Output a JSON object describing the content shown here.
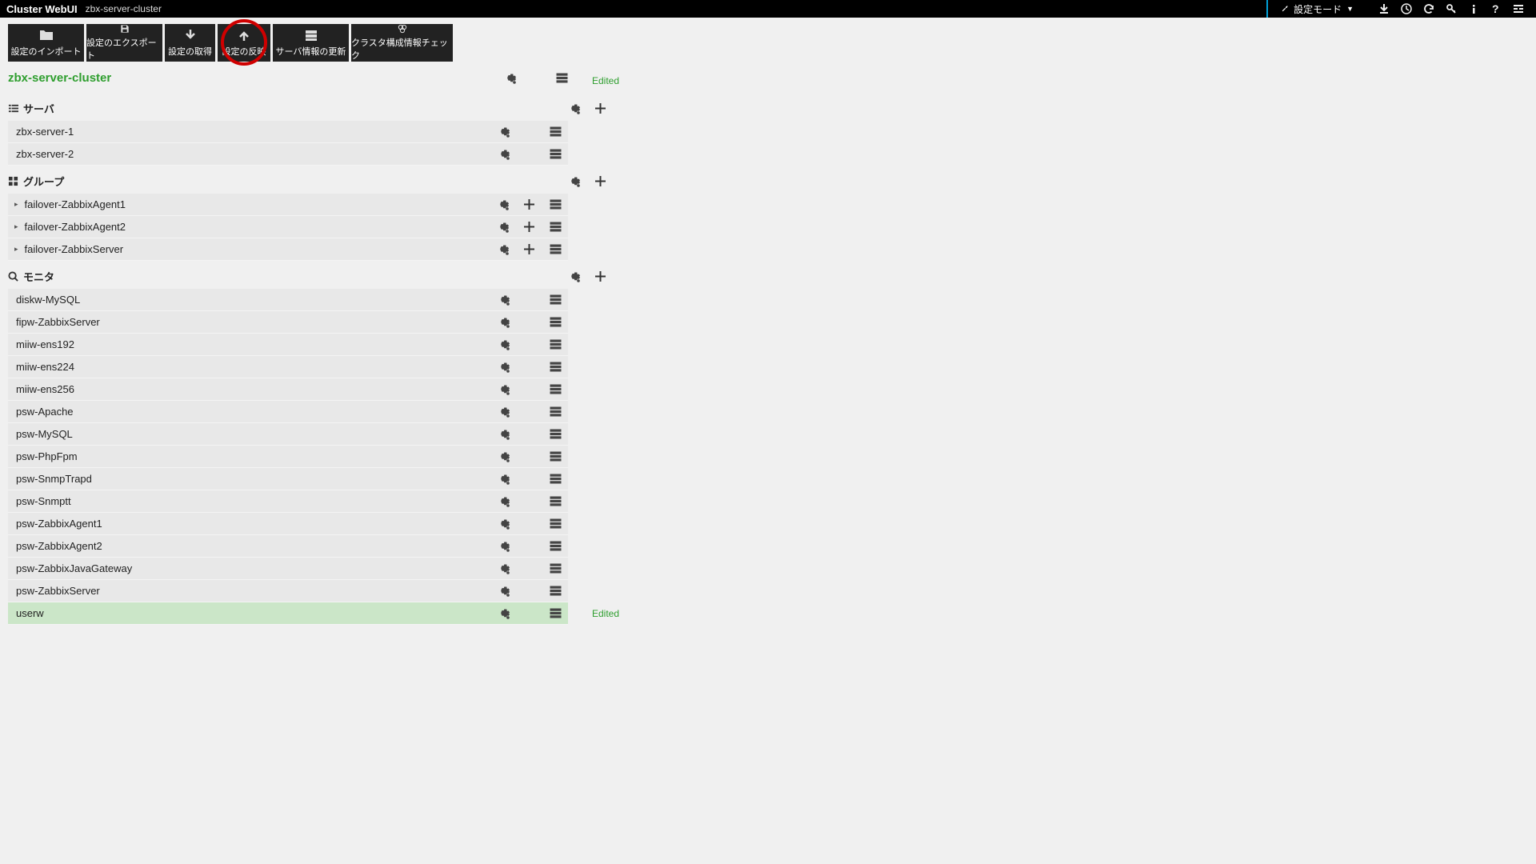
{
  "app": {
    "title": "Cluster WebUI",
    "cluster": "zbx-server-cluster"
  },
  "mode": {
    "label": "設定モード"
  },
  "toolbar": {
    "import": "設定のインポート",
    "export": "設定のエクスポート",
    "get": "設定の取得",
    "apply": "設定の反映",
    "server_update": "サーバ情報の更新",
    "config_check": "クラスタ構成情報チェック"
  },
  "labels": {
    "edited": "Edited"
  },
  "cluster_name": "zbx-server-cluster",
  "sections": {
    "servers": {
      "title": "サーバ",
      "items": [
        {
          "name": "zbx-server-1"
        },
        {
          "name": "zbx-server-2"
        }
      ]
    },
    "groups": {
      "title": "グループ",
      "items": [
        {
          "name": "failover-ZabbixAgent1"
        },
        {
          "name": "failover-ZabbixAgent2"
        },
        {
          "name": "failover-ZabbixServer"
        }
      ]
    },
    "monitors": {
      "title": "モニタ",
      "items": [
        {
          "name": "diskw-MySQL"
        },
        {
          "name": "fipw-ZabbixServer"
        },
        {
          "name": "miiw-ens192"
        },
        {
          "name": "miiw-ens224"
        },
        {
          "name": "miiw-ens256"
        },
        {
          "name": "psw-Apache"
        },
        {
          "name": "psw-MySQL"
        },
        {
          "name": "psw-PhpFpm"
        },
        {
          "name": "psw-SnmpTrapd"
        },
        {
          "name": "psw-Snmptt"
        },
        {
          "name": "psw-ZabbixAgent1"
        },
        {
          "name": "psw-ZabbixAgent2"
        },
        {
          "name": "psw-ZabbixJavaGateway"
        },
        {
          "name": "psw-ZabbixServer"
        },
        {
          "name": "userw",
          "edited": true
        }
      ]
    }
  }
}
